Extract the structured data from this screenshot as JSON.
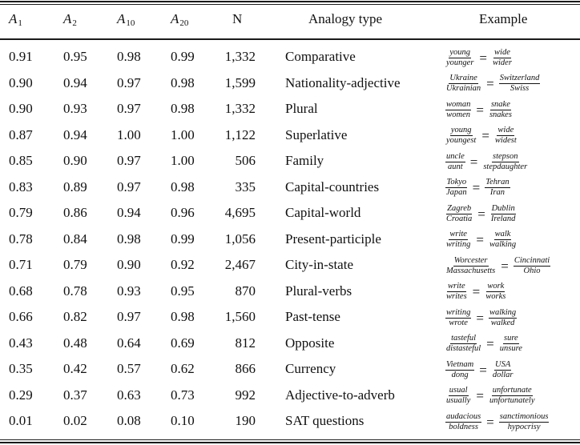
{
  "table": {
    "headers": {
      "a1": {
        "base": "A",
        "sub": "1"
      },
      "a2": {
        "base": "A",
        "sub": "2"
      },
      "a10": {
        "base": "A",
        "sub": "10"
      },
      "a20": {
        "base": "A",
        "sub": "20"
      },
      "n": "N",
      "type": "Analogy type",
      "example": "Example"
    },
    "rows": [
      {
        "a1": "0.91",
        "a2": "0.95",
        "a10": "0.98",
        "a20": "0.99",
        "n": "1,332",
        "type": "Comparative",
        "ex": {
          "n1": "young",
          "d1": "younger",
          "n2": "wide",
          "d2": "wider"
        }
      },
      {
        "a1": "0.90",
        "a2": "0.94",
        "a10": "0.97",
        "a20": "0.98",
        "n": "1,599",
        "type": "Nationality-adjective",
        "ex": {
          "n1": "Ukraine",
          "d1": "Ukrainian",
          "n2": "Switzerland",
          "d2": "Swiss"
        }
      },
      {
        "a1": "0.90",
        "a2": "0.93",
        "a10": "0.97",
        "a20": "0.98",
        "n": "1,332",
        "type": "Plural",
        "ex": {
          "n1": "woman",
          "d1": "women",
          "n2": "snake",
          "d2": "snakes"
        }
      },
      {
        "a1": "0.87",
        "a2": "0.94",
        "a10": "1.00",
        "a20": "1.00",
        "n": "1,122",
        "type": "Superlative",
        "ex": {
          "n1": "young",
          "d1": "youngest",
          "n2": "wide",
          "d2": "widest"
        }
      },
      {
        "a1": "0.85",
        "a2": "0.90",
        "a10": "0.97",
        "a20": "1.00",
        "n": "506",
        "type": "Family",
        "ex": {
          "n1": "uncle",
          "d1": "aunt",
          "n2": "stepson",
          "d2": "stepdaughter"
        }
      },
      {
        "a1": "0.83",
        "a2": "0.89",
        "a10": "0.97",
        "a20": "0.98",
        "n": "335",
        "type": "Capital-countries",
        "ex": {
          "n1": "Tokyo",
          "d1": "Japan",
          "n2": "Tehran",
          "d2": "Iran"
        }
      },
      {
        "a1": "0.79",
        "a2": "0.86",
        "a10": "0.94",
        "a20": "0.96",
        "n": "4,695",
        "type": "Capital-world",
        "ex": {
          "n1": "Zagreb",
          "d1": "Croatia",
          "n2": "Dublin",
          "d2": "Ireland"
        }
      },
      {
        "a1": "0.78",
        "a2": "0.84",
        "a10": "0.98",
        "a20": "0.99",
        "n": "1,056",
        "type": "Present-participle",
        "ex": {
          "n1": "write",
          "d1": "writing",
          "n2": "walk",
          "d2": "walking"
        }
      },
      {
        "a1": "0.71",
        "a2": "0.79",
        "a10": "0.90",
        "a20": "0.92",
        "n": "2,467",
        "type": "City-in-state",
        "ex": {
          "n1": "Worcester",
          "d1": "Massachusetts",
          "n2": "Cincinnati",
          "d2": "Ohio"
        }
      },
      {
        "a1": "0.68",
        "a2": "0.78",
        "a10": "0.93",
        "a20": "0.95",
        "n": "870",
        "type": "Plural-verbs",
        "ex": {
          "n1": "write",
          "d1": "writes",
          "n2": "work",
          "d2": "works"
        }
      },
      {
        "a1": "0.66",
        "a2": "0.82",
        "a10": "0.97",
        "a20": "0.98",
        "n": "1,560",
        "type": "Past-tense",
        "ex": {
          "n1": "writing",
          "d1": "wrote",
          "n2": "walking",
          "d2": "walked"
        }
      },
      {
        "a1": "0.43",
        "a2": "0.48",
        "a10": "0.64",
        "a20": "0.69",
        "n": "812",
        "type": "Opposite",
        "ex": {
          "n1": "tasteful",
          "d1": "distasteful",
          "n2": "sure",
          "d2": "unsure"
        }
      },
      {
        "a1": "0.35",
        "a2": "0.42",
        "a10": "0.57",
        "a20": "0.62",
        "n": "866",
        "type": "Currency",
        "ex": {
          "n1": "Vietnam",
          "d1": "dong",
          "n2": "USA",
          "d2": "dollar"
        }
      },
      {
        "a1": "0.29",
        "a2": "0.37",
        "a10": "0.63",
        "a20": "0.73",
        "n": "992",
        "type": "Adjective-to-adverb",
        "ex": {
          "n1": "usual",
          "d1": "usually",
          "n2": "unfortunate",
          "d2": "unfortunately"
        }
      },
      {
        "a1": "0.01",
        "a2": "0.02",
        "a10": "0.08",
        "a20": "0.10",
        "n": "190",
        "type": "SAT questions",
        "ex": {
          "n1": "audacious",
          "d1": "boldness",
          "n2": "sanctimonious",
          "d2": "hypocrisy"
        }
      }
    ],
    "equals_sign": "="
  }
}
